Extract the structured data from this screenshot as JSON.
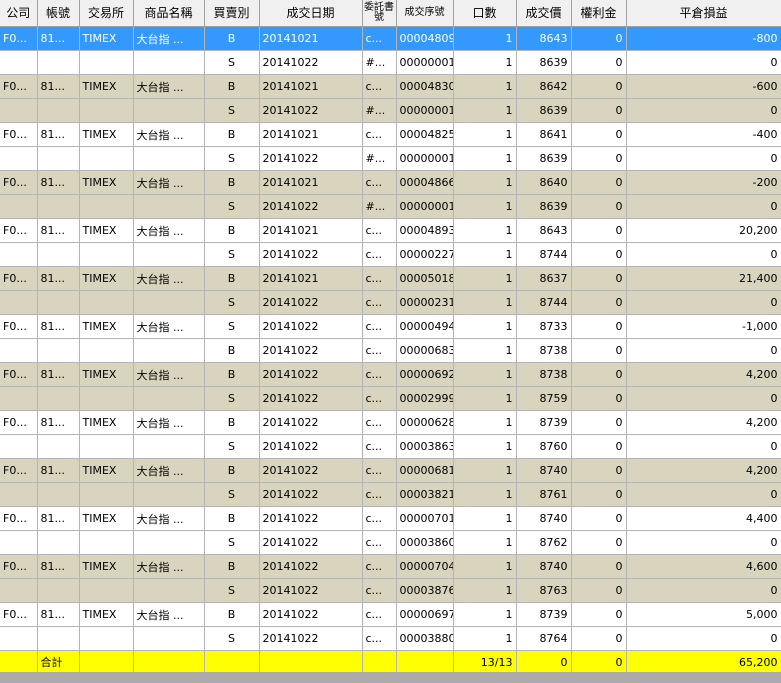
{
  "columns": [
    "公司",
    "帳號",
    "交易所",
    "商品名稱",
    "買賣別",
    "成交日期",
    "委託書號",
    "成交序號",
    "口數",
    "成交價",
    "權利金",
    "平倉損益"
  ],
  "rows": [
    {
      "company": "F0...",
      "account": "81...",
      "exchange": "TIMEX",
      "product": "大台指 ...",
      "side": "B",
      "date": "20141021",
      "order_no": "c...",
      "trade_no": "00004809",
      "qty": "1",
      "price": "8643",
      "premium": "0",
      "pnl": "-800",
      "style": "selected"
    },
    {
      "company": "",
      "account": "",
      "exchange": "",
      "product": "",
      "side": "S",
      "date": "20141022",
      "order_no": "#...",
      "trade_no": "00000001",
      "qty": "1",
      "price": "8639",
      "premium": "0",
      "pnl": "0",
      "style": "odd"
    },
    {
      "company": "F0...",
      "account": "81...",
      "exchange": "TIMEX",
      "product": "大台指 ...",
      "side": "B",
      "date": "20141021",
      "order_no": "c...",
      "trade_no": "00004830",
      "qty": "1",
      "price": "8642",
      "premium": "0",
      "pnl": "-600",
      "style": "tan"
    },
    {
      "company": "",
      "account": "",
      "exchange": "",
      "product": "",
      "side": "S",
      "date": "20141022",
      "order_no": "#...",
      "trade_no": "00000001",
      "qty": "1",
      "price": "8639",
      "premium": "0",
      "pnl": "0",
      "style": "tan"
    },
    {
      "company": "F0...",
      "account": "81...",
      "exchange": "TIMEX",
      "product": "大台指 ...",
      "side": "B",
      "date": "20141021",
      "order_no": "c...",
      "trade_no": "00004825",
      "qty": "1",
      "price": "8641",
      "premium": "0",
      "pnl": "-400",
      "style": "odd"
    },
    {
      "company": "",
      "account": "",
      "exchange": "",
      "product": "",
      "side": "S",
      "date": "20141022",
      "order_no": "#...",
      "trade_no": "00000001",
      "qty": "1",
      "price": "8639",
      "premium": "0",
      "pnl": "0",
      "style": "odd"
    },
    {
      "company": "F0...",
      "account": "81...",
      "exchange": "TIMEX",
      "product": "大台指 ...",
      "side": "B",
      "date": "20141021",
      "order_no": "c...",
      "trade_no": "00004866",
      "qty": "1",
      "price": "8640",
      "premium": "0",
      "pnl": "-200",
      "style": "tan"
    },
    {
      "company": "",
      "account": "",
      "exchange": "",
      "product": "",
      "side": "S",
      "date": "20141022",
      "order_no": "#...",
      "trade_no": "00000001",
      "qty": "1",
      "price": "8639",
      "premium": "0",
      "pnl": "0",
      "style": "tan"
    },
    {
      "company": "F0...",
      "account": "81...",
      "exchange": "TIMEX",
      "product": "大台指 ...",
      "side": "B",
      "date": "20141021",
      "order_no": "c...",
      "trade_no": "00004893",
      "qty": "1",
      "price": "8643",
      "premium": "0",
      "pnl": "20,200",
      "style": "odd"
    },
    {
      "company": "",
      "account": "",
      "exchange": "",
      "product": "",
      "side": "S",
      "date": "20141022",
      "order_no": "c...",
      "trade_no": "00000227",
      "qty": "1",
      "price": "8744",
      "premium": "0",
      "pnl": "0",
      "style": "odd"
    },
    {
      "company": "F0...",
      "account": "81...",
      "exchange": "TIMEX",
      "product": "大台指 ...",
      "side": "B",
      "date": "20141021",
      "order_no": "c...",
      "trade_no": "00005018",
      "qty": "1",
      "price": "8637",
      "premium": "0",
      "pnl": "21,400",
      "style": "tan"
    },
    {
      "company": "",
      "account": "",
      "exchange": "",
      "product": "",
      "side": "S",
      "date": "20141022",
      "order_no": "c...",
      "trade_no": "00000231",
      "qty": "1",
      "price": "8744",
      "premium": "0",
      "pnl": "0",
      "style": "tan"
    },
    {
      "company": "F0...",
      "account": "81...",
      "exchange": "TIMEX",
      "product": "大台指 ...",
      "side": "S",
      "date": "20141022",
      "order_no": "c...",
      "trade_no": "00000494",
      "qty": "1",
      "price": "8733",
      "premium": "0",
      "pnl": "-1,000",
      "style": "odd"
    },
    {
      "company": "",
      "account": "",
      "exchange": "",
      "product": "",
      "side": "B",
      "date": "20141022",
      "order_no": "c...",
      "trade_no": "00000683",
      "qty": "1",
      "price": "8738",
      "premium": "0",
      "pnl": "0",
      "style": "odd"
    },
    {
      "company": "F0...",
      "account": "81...",
      "exchange": "TIMEX",
      "product": "大台指 ...",
      "side": "B",
      "date": "20141022",
      "order_no": "c...",
      "trade_no": "00000692",
      "qty": "1",
      "price": "8738",
      "premium": "0",
      "pnl": "4,200",
      "style": "tan"
    },
    {
      "company": "",
      "account": "",
      "exchange": "",
      "product": "",
      "side": "S",
      "date": "20141022",
      "order_no": "c...",
      "trade_no": "00002999",
      "qty": "1",
      "price": "8759",
      "premium": "0",
      "pnl": "0",
      "style": "tan"
    },
    {
      "company": "F0...",
      "account": "81...",
      "exchange": "TIMEX",
      "product": "大台指 ...",
      "side": "B",
      "date": "20141022",
      "order_no": "c...",
      "trade_no": "00000628",
      "qty": "1",
      "price": "8739",
      "premium": "0",
      "pnl": "4,200",
      "style": "odd"
    },
    {
      "company": "",
      "account": "",
      "exchange": "",
      "product": "",
      "side": "S",
      "date": "20141022",
      "order_no": "c...",
      "trade_no": "00003863",
      "qty": "1",
      "price": "8760",
      "premium": "0",
      "pnl": "0",
      "style": "odd"
    },
    {
      "company": "F0...",
      "account": "81...",
      "exchange": "TIMEX",
      "product": "大台指 ...",
      "side": "B",
      "date": "20141022",
      "order_no": "c...",
      "trade_no": "00000681",
      "qty": "1",
      "price": "8740",
      "premium": "0",
      "pnl": "4,200",
      "style": "tan"
    },
    {
      "company": "",
      "account": "",
      "exchange": "",
      "product": "",
      "side": "S",
      "date": "20141022",
      "order_no": "c...",
      "trade_no": "00003821",
      "qty": "1",
      "price": "8761",
      "premium": "0",
      "pnl": "0",
      "style": "tan"
    },
    {
      "company": "F0...",
      "account": "81...",
      "exchange": "TIMEX",
      "product": "大台指 ...",
      "side": "B",
      "date": "20141022",
      "order_no": "c...",
      "trade_no": "00000701",
      "qty": "1",
      "price": "8740",
      "premium": "0",
      "pnl": "4,400",
      "style": "odd"
    },
    {
      "company": "",
      "account": "",
      "exchange": "",
      "product": "",
      "side": "S",
      "date": "20141022",
      "order_no": "c...",
      "trade_no": "00003860",
      "qty": "1",
      "price": "8762",
      "premium": "0",
      "pnl": "0",
      "style": "odd"
    },
    {
      "company": "F0...",
      "account": "81...",
      "exchange": "TIMEX",
      "product": "大台指 ...",
      "side": "B",
      "date": "20141022",
      "order_no": "c...",
      "trade_no": "00000704",
      "qty": "1",
      "price": "8740",
      "premium": "0",
      "pnl": "4,600",
      "style": "tan"
    },
    {
      "company": "",
      "account": "",
      "exchange": "",
      "product": "",
      "side": "S",
      "date": "20141022",
      "order_no": "c...",
      "trade_no": "00003876",
      "qty": "1",
      "price": "8763",
      "premium": "0",
      "pnl": "0",
      "style": "tan"
    },
    {
      "company": "F0...",
      "account": "81...",
      "exchange": "TIMEX",
      "product": "大台指 ...",
      "side": "B",
      "date": "20141022",
      "order_no": "c...",
      "trade_no": "00000697",
      "qty": "1",
      "price": "8739",
      "premium": "0",
      "pnl": "5,000",
      "style": "odd"
    },
    {
      "company": "",
      "account": "",
      "exchange": "",
      "product": "",
      "side": "S",
      "date": "20141022",
      "order_no": "c...",
      "trade_no": "00003880",
      "qty": "1",
      "price": "8764",
      "premium": "0",
      "pnl": "0",
      "style": "odd"
    }
  ],
  "total": {
    "label": "合計",
    "qty": "13/13",
    "price": "0",
    "premium": "0",
    "pnl": "65,200"
  },
  "colors": {
    "header_bg": "#f0f0f0",
    "selected_row": "#3399ff",
    "alt_row": "#d8d4bd",
    "total_row": "#ffff00"
  }
}
